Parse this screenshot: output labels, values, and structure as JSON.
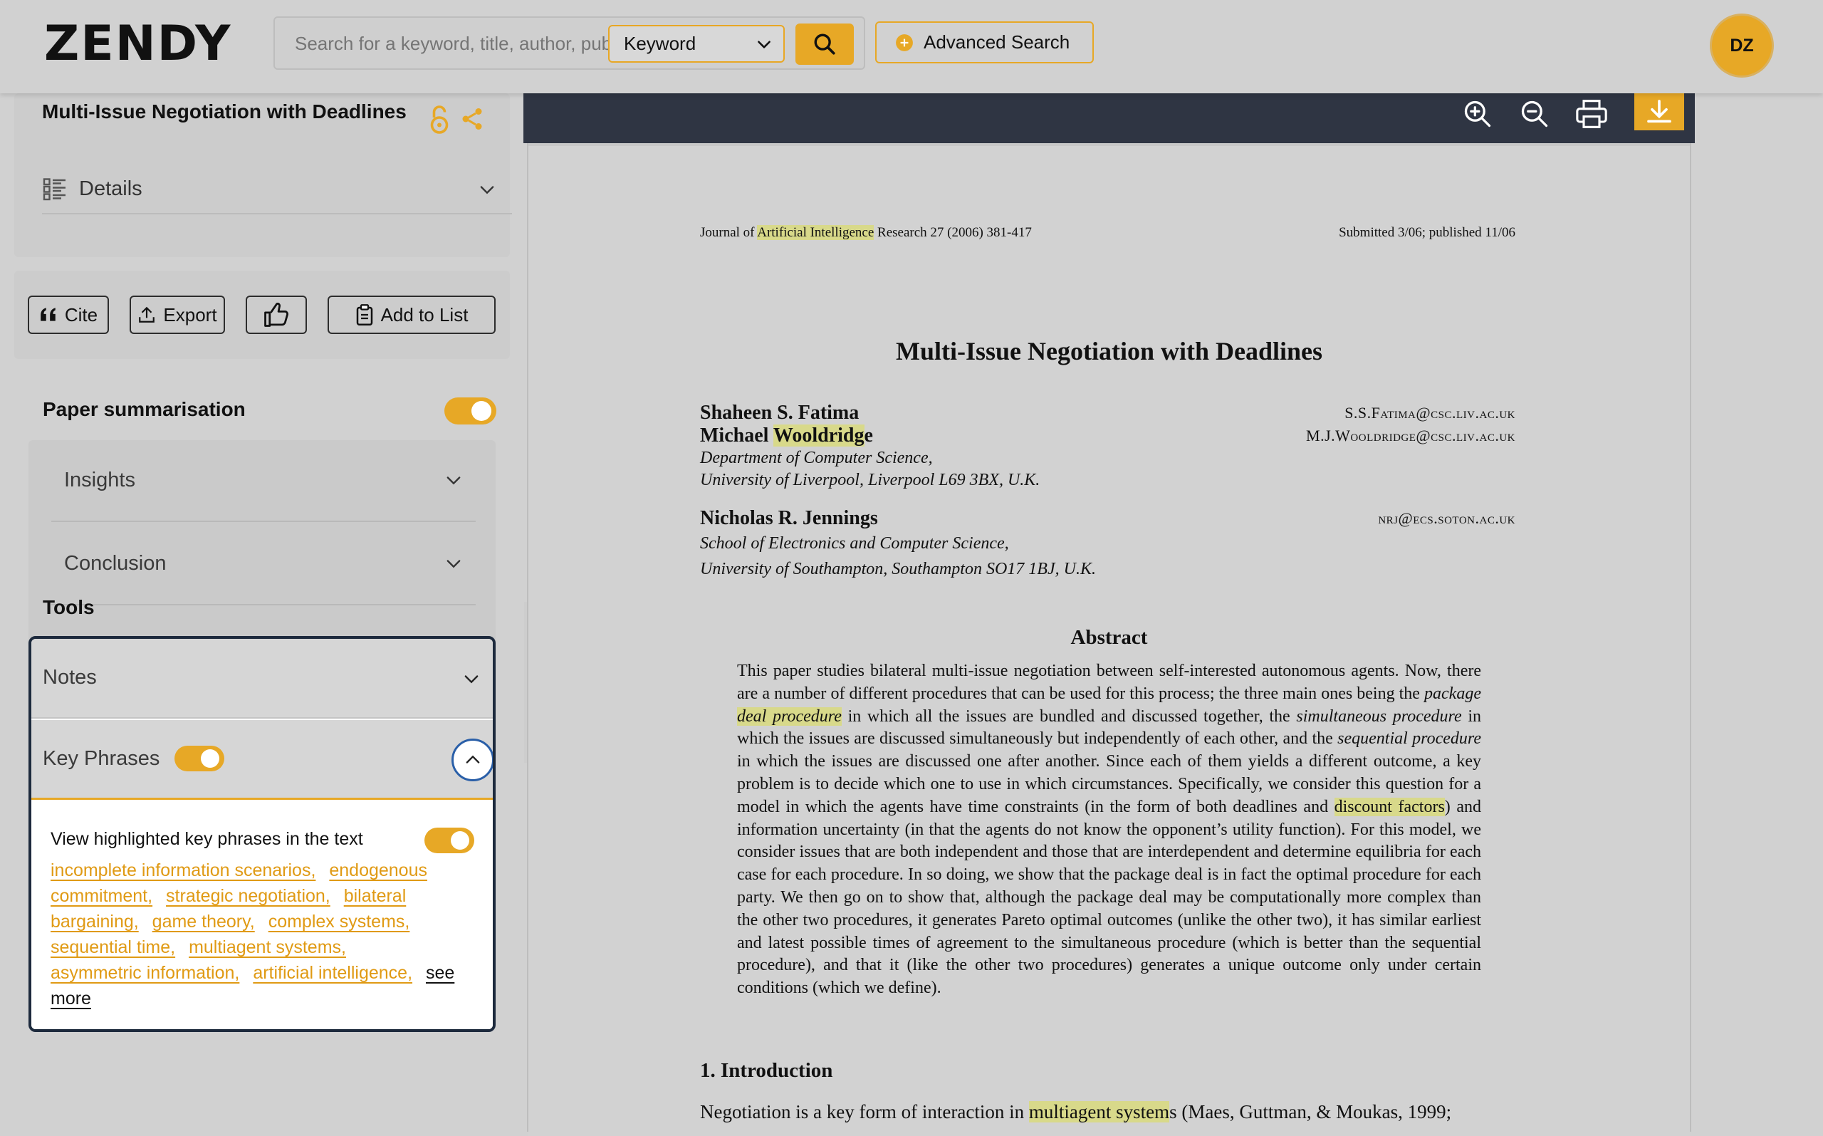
{
  "header": {
    "logo": "ZENDY",
    "search_placeholder": "Search for a keyword, title, author, publisher",
    "search_type": "Keyword",
    "advanced_search": "Advanced Search",
    "avatar_initials": "DZ"
  },
  "sidebar": {
    "title": "Multi-Issue Negotiation with Deadlines",
    "details_label": "Details",
    "actions": {
      "cite": "Cite",
      "export": "Export",
      "add_to_list": "Add to List"
    },
    "summarisation": {
      "heading": "Paper summarisation",
      "enabled": true,
      "sections": [
        "Insights",
        "Conclusion"
      ]
    },
    "tools": {
      "heading": "Tools",
      "notes_label": "Notes",
      "key_phrases_label": "Key Phrases",
      "key_phrases_enabled": true,
      "view_highlighted_label": "View highlighted key phrases in the text",
      "view_highlighted_enabled": true,
      "phrases": [
        "incomplete information scenarios,",
        "endogenous commitment,",
        "strategic negotiation,",
        "bilateral bargaining,",
        "game theory,",
        "complex systems,",
        "sequential time,",
        "multiagent systems,",
        "asymmetric information,",
        "artificial intelligence,"
      ],
      "see_more": "see more"
    }
  },
  "colors": {
    "accent": "#e7a826",
    "toolbar": "#2f3543",
    "highlight": "#d8d98a"
  },
  "paper": {
    "journal_pre": "Journal of ",
    "journal_hl": "Artificial Intelligence",
    "journal_post": " Research 27 (2006) 381-417",
    "submitted": "Submitted 3/06; published 11/06",
    "title": "Multi-Issue Negotiation with Deadlines",
    "author1": "Shaheen S. Fatima",
    "email1": "S.S.Fatima@csc.liv.ac.uk",
    "author2_pre": "Michael ",
    "author2_hl": "Wooldridg",
    "author2_post": "e",
    "email2": "M.J.Wooldridge@csc.liv.ac.uk",
    "affil1_line1": "Department of Computer Science,",
    "affil1_line2": "University of Liverpool, Liverpool L69 3BX, U.K.",
    "author3": "Nicholas R. Jennings",
    "email3": "nrj@ecs.soton.ac.uk",
    "affil2_line1": "School of Electronics and Computer Science,",
    "affil2_line2": "University of Southampton, Southampton SO17 1BJ, U.K.",
    "abstract_heading": "Abstract",
    "abstract": {
      "p1": "This paper studies bilateral multi-issue negotiation between self-interested autonomous agents. Now, there are a number of different procedures that can be used for this process; the three main ones being the ",
      "i1": "package ",
      "hl1": "deal procedure",
      "p2": " in which all the issues are bundled and discussed together, the ",
      "i2": "simultaneous procedure",
      "p3": " in which the issues are discussed simultaneously but independently of each other, and the ",
      "i3": "sequential procedure",
      "p4": " in which the issues are discussed one after another. Since each of them yields a different outcome, a key problem is to decide which one to use in which circumstances. Specifically, we consider this question for a model in which the agents have time constraints (in the form of both deadlines and ",
      "hl2": "discount factors",
      "p5": ") and information uncertainty (in that the agents do not know the opponent’s utility function). For this model, we consider issues that are both independent and those that are interdependent and determine equilibria for each case for each procedure. In so doing, we show that the package deal is in fact the optimal procedure for each party. We then go on to show that, although the package deal may be computationally more complex than the other two procedures, it generates Pareto optimal outcomes (unlike the other two), it has similar earliest and latest possible times of agreement to the simultaneous procedure (which is better than the sequential procedure), and that it (like the other two procedures) generates a unique outcome only under certain conditions (which we define)."
    },
    "intro_heading": "1. Introduction",
    "intro_pre": "Negotiation is a key form of interaction in ",
    "intro_hl": "multiagent system",
    "intro_post": "s (Maes, Guttman, & Moukas, 1999;"
  }
}
